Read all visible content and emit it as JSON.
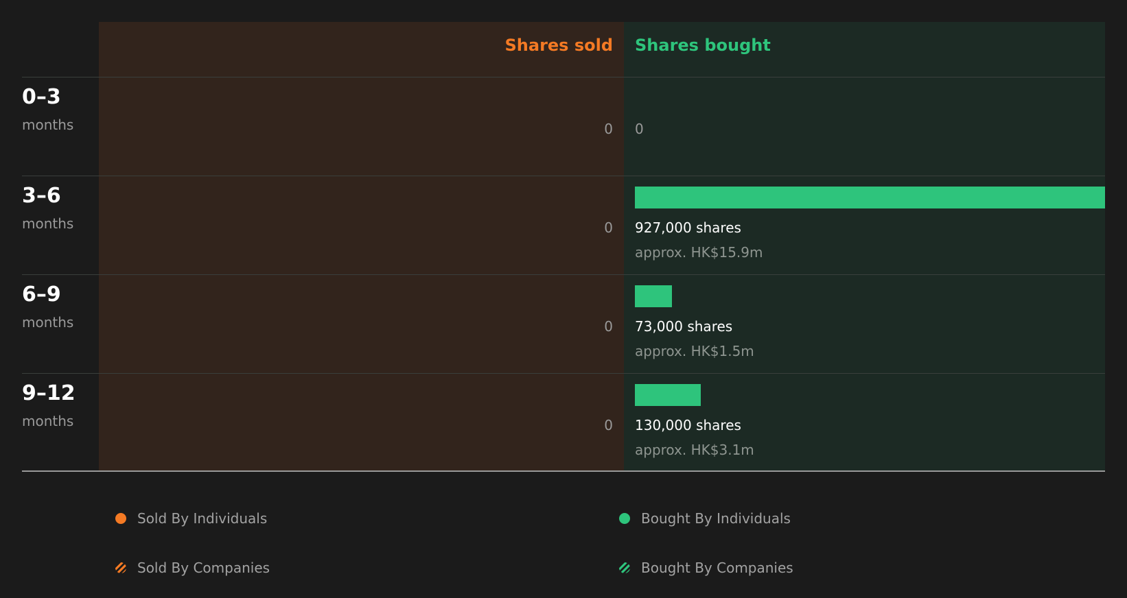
{
  "chart_data": {
    "type": "bar",
    "headers": {
      "sold": "Shares sold",
      "bought": "Shares bought"
    },
    "categories": [
      {
        "range": "0-3",
        "unit": "months"
      },
      {
        "range": "3-6",
        "unit": "months"
      },
      {
        "range": "6-9",
        "unit": "months"
      },
      {
        "range": "9-12",
        "unit": "months"
      }
    ],
    "sold_labels": [
      "0",
      "0",
      "0",
      "0"
    ],
    "series": [
      {
        "name": "Shares sold",
        "values": [
          0,
          0,
          0,
          0
        ]
      },
      {
        "name": "Shares bought",
        "values": [
          0,
          927000,
          73000,
          130000
        ]
      }
    ],
    "bought_labels": [
      {
        "zero": "0",
        "shares": "",
        "approx": ""
      },
      {
        "zero": "",
        "shares": "927,000 shares",
        "approx": "approx. HK$15.9m"
      },
      {
        "zero": "",
        "shares": "73,000 shares",
        "approx": "approx. HK$1.5m"
      },
      {
        "zero": "",
        "shares": "130,000 shares",
        "approx": "approx. HK$3.1m"
      }
    ],
    "legend": [
      {
        "label": "Sold By Individuals",
        "style": "solid",
        "color": "#f47a24"
      },
      {
        "label": "Sold By Companies",
        "style": "hatched",
        "color": "#f47a24"
      },
      {
        "label": "Bought By Individuals",
        "style": "solid",
        "color": "#2ec47c"
      },
      {
        "label": "Bought By Companies",
        "style": "hatched",
        "color": "#2ec47c"
      }
    ],
    "colors": {
      "sold": "#f47a24",
      "bought": "#2ec47c"
    }
  }
}
